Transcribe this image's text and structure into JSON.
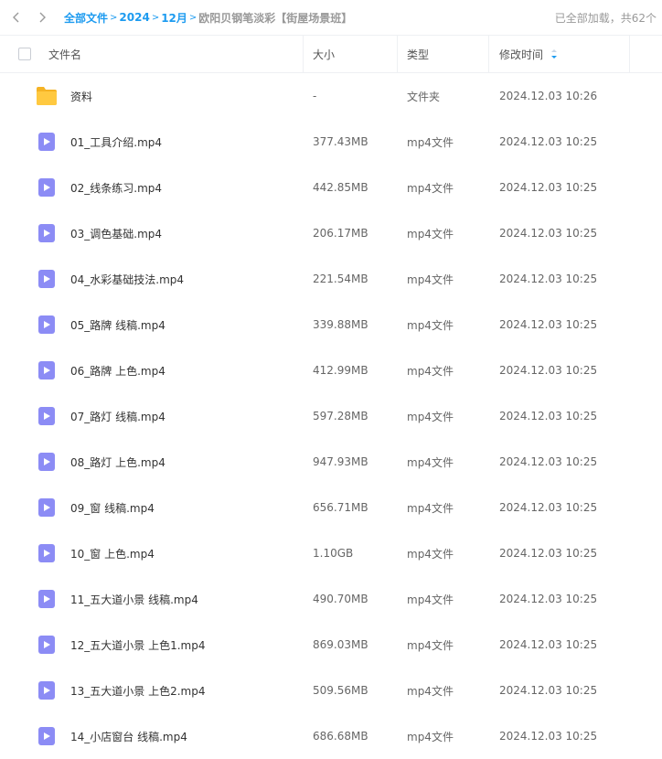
{
  "nav": {
    "breadcrumbs": [
      "全部文件",
      "2024",
      "12月"
    ],
    "current_folder": "欧阳贝钢笔淡彩【街屋场景班】",
    "load_status": "已全部加载，共62个"
  },
  "table": {
    "headers": {
      "name": "文件名",
      "size": "大小",
      "type": "类型",
      "modified": "修改时间"
    },
    "rows": [
      {
        "name": "资料",
        "size": "-",
        "type": "文件夹",
        "modified": "2024.12.03 10:26",
        "icon": "folder-icon"
      },
      {
        "name": "01_工具介绍.mp4",
        "size": "377.43MB",
        "type": "mp4文件",
        "modified": "2024.12.03 10:25",
        "icon": "video-file-icon"
      },
      {
        "name": "02_线条练习.mp4",
        "size": "442.85MB",
        "type": "mp4文件",
        "modified": "2024.12.03 10:25",
        "icon": "video-file-icon"
      },
      {
        "name": "03_调色基础.mp4",
        "size": "206.17MB",
        "type": "mp4文件",
        "modified": "2024.12.03 10:25",
        "icon": "video-file-icon"
      },
      {
        "name": "04_水彩基础技法.mp4",
        "size": "221.54MB",
        "type": "mp4文件",
        "modified": "2024.12.03 10:25",
        "icon": "video-file-icon"
      },
      {
        "name": "05_路牌 线稿.mp4",
        "size": "339.88MB",
        "type": "mp4文件",
        "modified": "2024.12.03 10:25",
        "icon": "video-file-icon"
      },
      {
        "name": "06_路牌 上色.mp4",
        "size": "412.99MB",
        "type": "mp4文件",
        "modified": "2024.12.03 10:25",
        "icon": "video-file-icon"
      },
      {
        "name": "07_路灯 线稿.mp4",
        "size": "597.28MB",
        "type": "mp4文件",
        "modified": "2024.12.03 10:25",
        "icon": "video-file-icon"
      },
      {
        "name": "08_路灯 上色.mp4",
        "size": "947.93MB",
        "type": "mp4文件",
        "modified": "2024.12.03 10:25",
        "icon": "video-file-icon"
      },
      {
        "name": "09_窗 线稿.mp4",
        "size": "656.71MB",
        "type": "mp4文件",
        "modified": "2024.12.03 10:25",
        "icon": "video-file-icon"
      },
      {
        "name": "10_窗 上色.mp4",
        "size": "1.10GB",
        "type": "mp4文件",
        "modified": "2024.12.03 10:25",
        "icon": "video-file-icon"
      },
      {
        "name": "11_五大道小景 线稿.mp4",
        "size": "490.70MB",
        "type": "mp4文件",
        "modified": "2024.12.03 10:25",
        "icon": "video-file-icon"
      },
      {
        "name": "12_五大道小景 上色1.mp4",
        "size": "869.03MB",
        "type": "mp4文件",
        "modified": "2024.12.03 10:25",
        "icon": "video-file-icon"
      },
      {
        "name": "13_五大道小景 上色2.mp4",
        "size": "509.56MB",
        "type": "mp4文件",
        "modified": "2024.12.03 10:25",
        "icon": "video-file-icon"
      },
      {
        "name": "14_小店窗台 线稿.mp4",
        "size": "686.68MB",
        "type": "mp4文件",
        "modified": "2024.12.03 10:25",
        "icon": "video-file-icon"
      }
    ]
  },
  "colors": {
    "accent": "#1d9bf0",
    "folder": "#ffc940",
    "video_icon": "#8c8cf5"
  }
}
